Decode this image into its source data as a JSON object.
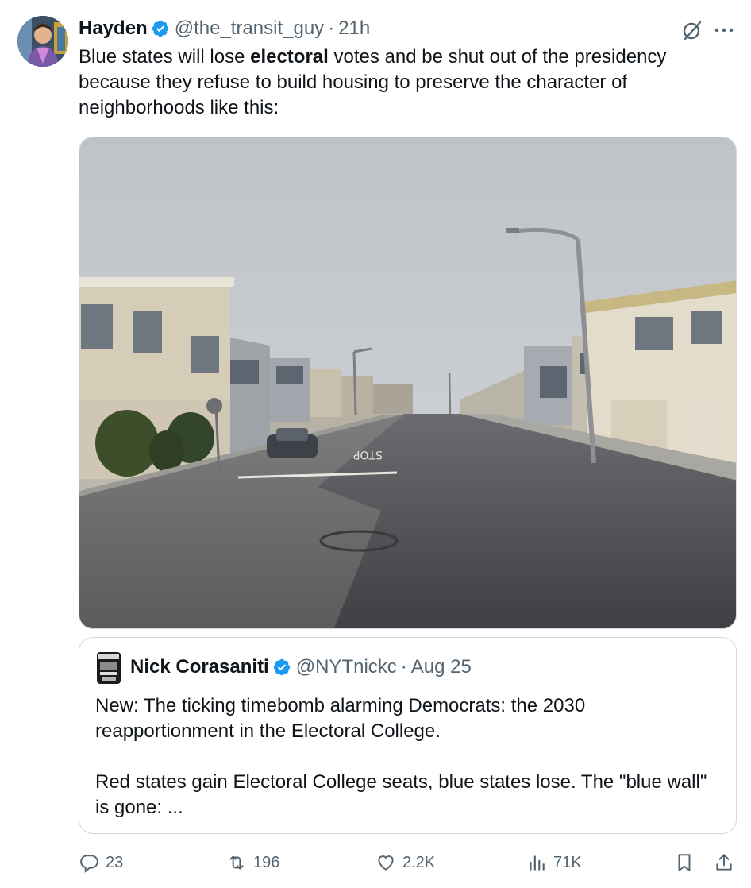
{
  "tweet": {
    "author": {
      "name": "Hayden",
      "handle": "@the_transit_guy",
      "time": "21h",
      "verified": true,
      "avatar_icon": "user-avatar"
    },
    "text_before": "Blue states will lose ",
    "text_bold": "electoral",
    "text_after": " votes and be shut out of the presidency because they refuse to build housing to preserve the character of neighborhoods like this:",
    "image_icon": "street-photo",
    "separator": "·"
  },
  "quote": {
    "author": {
      "name": "Nick Corasaniti",
      "handle": "@NYTnickc",
      "time": "Aug 25",
      "verified": true
    },
    "paragraph1": "New: The ticking timebomb alarming Democrats: the 2030 reapportionment in the Electoral College.",
    "paragraph2": "Red states gain Electoral College seats, blue states lose. The \"blue wall\" is gone: ..."
  },
  "actions": {
    "replies": "23",
    "reposts": "196",
    "likes": "2.2K",
    "views": "71K"
  },
  "colors": {
    "text": "#0f1419",
    "secondary": "#536471",
    "verified": "#1d9bf0",
    "border": "#cfd9de"
  }
}
